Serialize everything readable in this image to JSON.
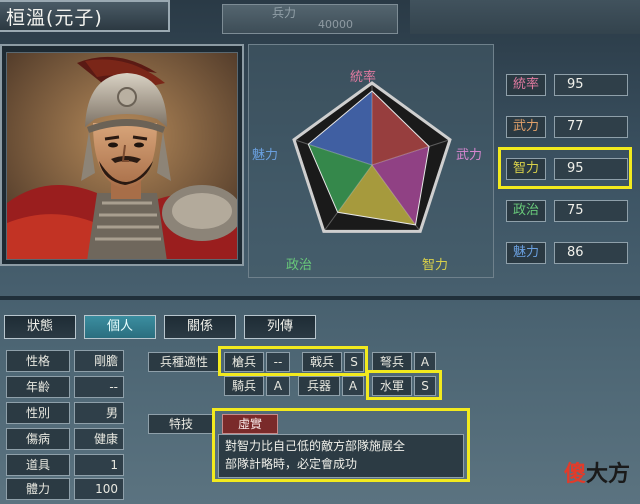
{
  "header": {
    "officer_name": "桓溫(元子)",
    "soldiers_label": "兵力",
    "soldiers_value": "40000"
  },
  "radar": {
    "labels": {
      "leadership": "統率",
      "war": "武力",
      "intelligence": "智力",
      "politics": "政治",
      "charm": "魅力"
    },
    "max": 100,
    "colors": {
      "leadership": "#c24b4b",
      "war": "#b84fa8",
      "intelligence": "#d6c64a",
      "politics": "#3fae5c",
      "charm": "#4d77d0"
    }
  },
  "stats": [
    {
      "label": "統率",
      "value": "95",
      "highlight": false
    },
    {
      "label": "武力",
      "value": "77",
      "highlight": false
    },
    {
      "label": "智力",
      "value": "95",
      "highlight": true
    },
    {
      "label": "政治",
      "value": "75",
      "highlight": false
    },
    {
      "label": "魅力",
      "value": "86",
      "highlight": false
    }
  ],
  "stat_label_colors": [
    "#e07aa0",
    "#e0a06a",
    "#d8d04a",
    "#68c97a",
    "#6aa0e0"
  ],
  "tabs": [
    {
      "label": "狀態",
      "active": false
    },
    {
      "label": "個人",
      "active": true
    },
    {
      "label": "關係",
      "active": false
    },
    {
      "label": "列傳",
      "active": false
    }
  ],
  "attributes": [
    {
      "label": "性格",
      "value": "剛膽"
    },
    {
      "label": "年齡",
      "value": "--"
    },
    {
      "label": "性別",
      "value": "男"
    },
    {
      "label": "傷病",
      "value": "健康"
    },
    {
      "label": "道具",
      "value": "1"
    },
    {
      "label": "體力",
      "value": "100"
    }
  ],
  "aptitude": {
    "title": "兵種適性",
    "units": [
      {
        "name": "槍兵",
        "grade": "--"
      },
      {
        "name": "戟兵",
        "grade": "S"
      },
      {
        "name": "弩兵",
        "grade": "A"
      },
      {
        "name": "騎兵",
        "grade": "A"
      },
      {
        "name": "兵器",
        "grade": "A"
      },
      {
        "name": "水軍",
        "grade": "S"
      }
    ]
  },
  "skill": {
    "title": "特技",
    "name": "虛實",
    "description_line1": "對智力比自己低的敵方部隊施展全",
    "description_line2": "部隊計略時，必定會成功"
  },
  "watermark": {
    "text1": "傻",
    "text2": "大方",
    "color1": "#e23b2a",
    "color2": "#1a1a1a"
  }
}
